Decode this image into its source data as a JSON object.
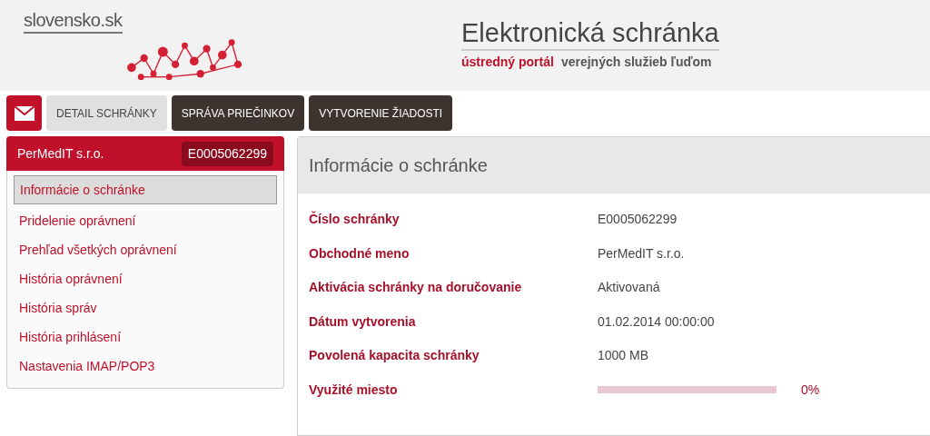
{
  "header": {
    "logo": "slovensko.sk",
    "title": "Elektronická schránka",
    "subtitle_highlight": "ústredný portál",
    "subtitle_rest": "verejných služieb ľuďom"
  },
  "tabs": [
    {
      "label": "DETAIL SCHRÁNKY",
      "selected": true
    },
    {
      "label": "SPRÁVA PRIEČINKOV",
      "selected": false
    },
    {
      "label": "VYTVORENIE ŽIADOSTI",
      "selected": false
    }
  ],
  "sidebar": {
    "owner": "PerMedIT s.r.o.",
    "box_id": "E0005062299",
    "items": [
      {
        "label": "Informácie o schránke",
        "selected": true
      },
      {
        "label": "Pridelenie oprávnení",
        "selected": false
      },
      {
        "label": "Prehľad všetkých oprávnení",
        "selected": false
      },
      {
        "label": "História oprávnení",
        "selected": false
      },
      {
        "label": "História správ",
        "selected": false
      },
      {
        "label": "História prihlásení",
        "selected": false
      },
      {
        "label": "Nastavenia IMAP/POP3",
        "selected": false
      }
    ]
  },
  "panel": {
    "title": "Informácie o schránke",
    "rows": [
      {
        "kind": "text",
        "label": "Číslo schránky",
        "value": "E0005062299"
      },
      {
        "kind": "text",
        "label": "Obchodné meno",
        "value": "PerMedIT s.r.o."
      },
      {
        "kind": "text",
        "label": "Aktivácia schránky na doručovanie",
        "value": "Aktivovaná"
      },
      {
        "kind": "text",
        "label": "Dátum vytvorenia",
        "value": "01.02.2014 00:00:00"
      },
      {
        "kind": "text",
        "label": "Povolená kapacita schránky",
        "value": "1000 MB"
      },
      {
        "kind": "meter",
        "label": "Využité miesto",
        "level": 0,
        "reading": "0%"
      }
    ]
  }
}
